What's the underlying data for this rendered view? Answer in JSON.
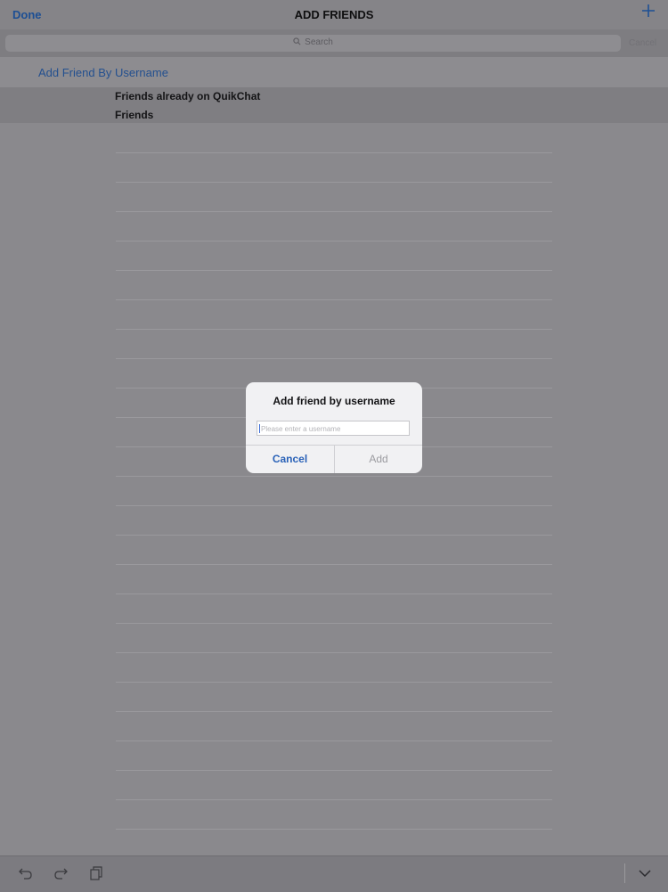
{
  "navbar": {
    "done_label": "Done",
    "title": "ADD FRIENDS",
    "add_icon": "plus-icon"
  },
  "search": {
    "placeholder": "Search",
    "cancel_label": "Cancel",
    "icon": "search-icon"
  },
  "sections": {
    "add_by_username_label": "Add Friend By Username",
    "header_line1": "Friends already on QuikChat",
    "header_line2": "Friends"
  },
  "dialog": {
    "title": "Add friend by username",
    "input_placeholder": "Please enter a username",
    "input_value": "",
    "cancel_label": "Cancel",
    "add_label": "Add"
  },
  "toolbar": {
    "icons": [
      "undo-icon",
      "redo-icon",
      "clipboard-icon",
      "chevron-down-icon"
    ]
  },
  "colors": {
    "accent": "#2a62b8",
    "dim_overlay": "#8a898d",
    "dialog_background": "#f1f1f3"
  }
}
